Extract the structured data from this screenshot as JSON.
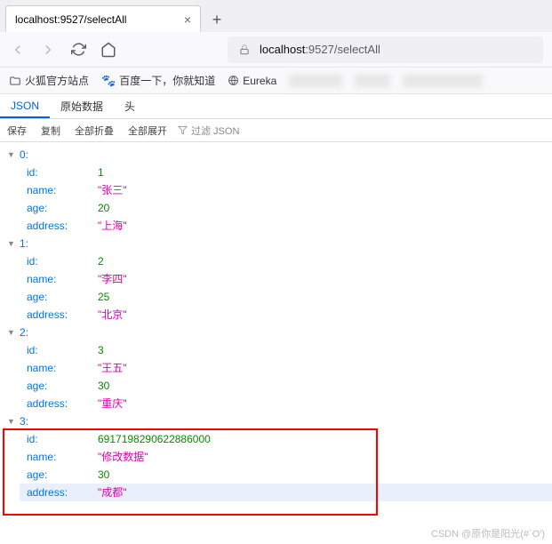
{
  "tab": {
    "title": "localhost:9527/selectAll",
    "close": "×",
    "new": "+"
  },
  "url": {
    "host": "localhost",
    "rest": ":9527/selectAll"
  },
  "bookmarks": {
    "b0": "火狐官方站点",
    "b1": "百度一下，你就知道",
    "b2": "Eureka"
  },
  "dtabs": {
    "json": "JSON",
    "raw": "原始数据",
    "head": "头"
  },
  "toolbar": {
    "save": "保存",
    "copy": "复制",
    "collapse": "全部折叠",
    "expand": "全部展开",
    "filter": "过滤 JSON"
  },
  "items": [
    {
      "idx": "0:",
      "id_k": "id:",
      "id_v": "1",
      "name_k": "name:",
      "name_v": "\"张三\"",
      "age_k": "age:",
      "age_v": "20",
      "addr_k": "address:",
      "addr_v": "\"上海\""
    },
    {
      "idx": "1:",
      "id_k": "id:",
      "id_v": "2",
      "name_k": "name:",
      "name_v": "\"李四\"",
      "age_k": "age:",
      "age_v": "25",
      "addr_k": "address:",
      "addr_v": "\"北京\""
    },
    {
      "idx": "2:",
      "id_k": "id:",
      "id_v": "3",
      "name_k": "name:",
      "name_v": "\"王五\"",
      "age_k": "age:",
      "age_v": "30",
      "addr_k": "address:",
      "addr_v": "\"重庆\""
    },
    {
      "idx": "3:",
      "id_k": "id:",
      "id_v": "6917198290622886000",
      "name_k": "name:",
      "name_v": "\"修改数据\"",
      "age_k": "age:",
      "age_v": "30",
      "addr_k": "address:",
      "addr_v": "\"成都\""
    }
  ],
  "watermark": "CSDN @原你是阳光(#`O′)"
}
